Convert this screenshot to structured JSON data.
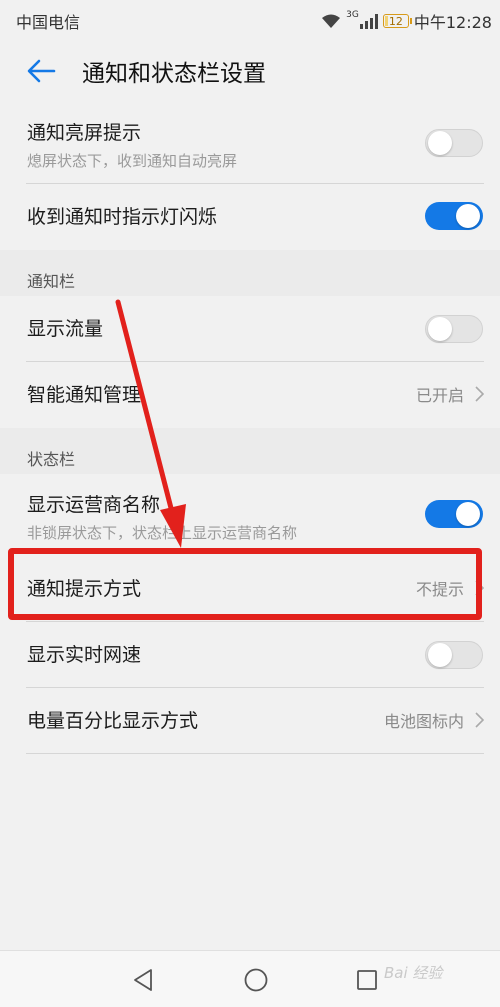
{
  "status_bar": {
    "carrier": "中国电信",
    "network_type": "3G",
    "battery": "12",
    "battery_level_percent": 12,
    "time": "中午12:28"
  },
  "header": {
    "title": "通知和状态栏设置"
  },
  "rows": {
    "screen_wake": {
      "title": "通知亮屏提示",
      "subtitle": "熄屏状态下，收到通知自动亮屏",
      "enabled": false
    },
    "led_blink": {
      "title": "收到通知时指示灯闪烁",
      "enabled": true
    },
    "show_traffic": {
      "title": "显示流量",
      "enabled": false
    },
    "smart_notification": {
      "title": "智能通知管理",
      "value": "已开启"
    },
    "carrier_name": {
      "title": "显示运营商名称",
      "subtitle": "非锁屏状态下，状态栏上显示运营商名称",
      "enabled": true
    },
    "notify_style": {
      "title": "通知提示方式",
      "value": "不提示"
    },
    "net_speed": {
      "title": "显示实时网速",
      "enabled": false
    },
    "battery_percent": {
      "title": "电量百分比显示方式",
      "value": "电池图标内"
    }
  },
  "sections": {
    "notification_bar": "通知栏",
    "status_bar": "状态栏"
  },
  "watermark": "Bai 经验",
  "colors": {
    "toggle_on": "#1479e6",
    "annotation": "#e2211c"
  }
}
